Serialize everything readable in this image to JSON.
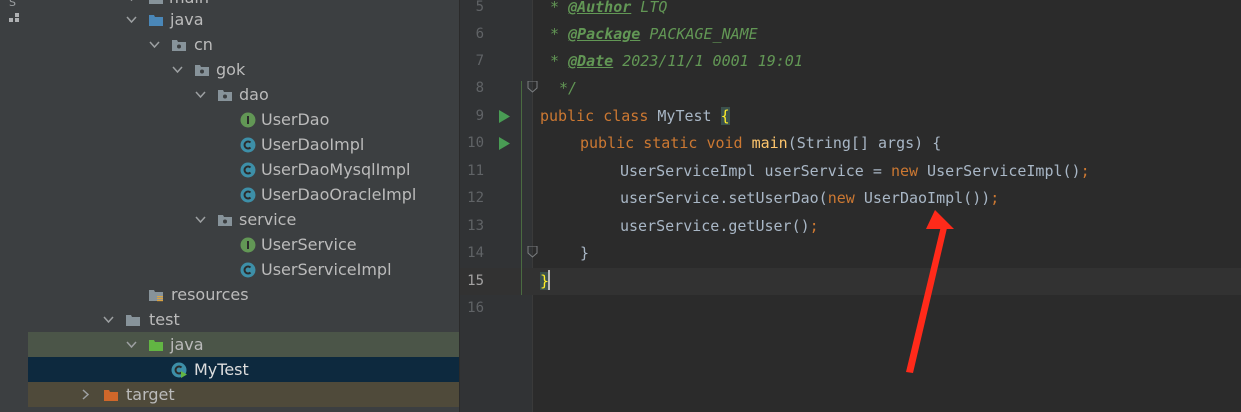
{
  "sidebar_strip": {
    "letter": "S"
  },
  "project_tree": {
    "partial_top_label": "main",
    "items": [
      {
        "label": "java",
        "icon": "folder-source-icon"
      },
      {
        "label": "cn",
        "icon": "package-icon"
      },
      {
        "label": "gok",
        "icon": "package-icon"
      },
      {
        "label": "dao",
        "icon": "package-icon"
      },
      {
        "label": "UserDao",
        "icon": "interface-icon"
      },
      {
        "label": "UserDaoImpl",
        "icon": "class-icon"
      },
      {
        "label": "UserDaoMysqlImpl",
        "icon": "class-icon"
      },
      {
        "label": "UserDaoOracleImpl",
        "icon": "class-icon"
      },
      {
        "label": "service",
        "icon": "package-icon"
      },
      {
        "label": "UserService",
        "icon": "interface-icon"
      },
      {
        "label": "UserServiceImpl",
        "icon": "class-icon"
      },
      {
        "label": "resources",
        "icon": "resources-folder-icon"
      },
      {
        "label": "test",
        "icon": "folder-icon"
      },
      {
        "label": "java",
        "icon": "test-source-folder-icon"
      },
      {
        "label": "MyTest",
        "icon": "runnable-class-icon"
      },
      {
        "label": "target",
        "icon": "excluded-folder-icon"
      }
    ]
  },
  "editor": {
    "current_line": 15,
    "lines": [
      {
        "num": "5",
        "tag": "@Author",
        "text": " LTQ"
      },
      {
        "num": "6",
        "tag": "@Package",
        "text": " PACKAGE_NAME"
      },
      {
        "num": "7",
        "tag": "@Date",
        "text": " 2023/11/1 0001 19:01"
      },
      {
        "num": "8",
        "text": " */"
      },
      {
        "num": "9",
        "kw1": "public",
        "kw2": "class",
        "name": "MyTest",
        "brace": "{"
      },
      {
        "num": "10",
        "kw1": "public",
        "kw2": "static",
        "kw3": "void",
        "fn": "main",
        "rest": "(String[] args) {"
      },
      {
        "num": "11",
        "a": "UserServiceImpl userService = ",
        "kw": "new",
        "b": " UserServiceImpl()",
        "semi": ";"
      },
      {
        "num": "12",
        "a": "userService.setUserDao(",
        "kw": "new",
        "b": " UserDaoImpl())",
        "semi": ";"
      },
      {
        "num": "13",
        "a": "userService.getUser()",
        "semi": ";"
      },
      {
        "num": "14",
        "text": "}"
      },
      {
        "num": "15",
        "text": "}"
      },
      {
        "num": "16",
        "text": ""
      }
    ],
    "doc_star": "*",
    "annotation_color": "#ff2a1a"
  }
}
